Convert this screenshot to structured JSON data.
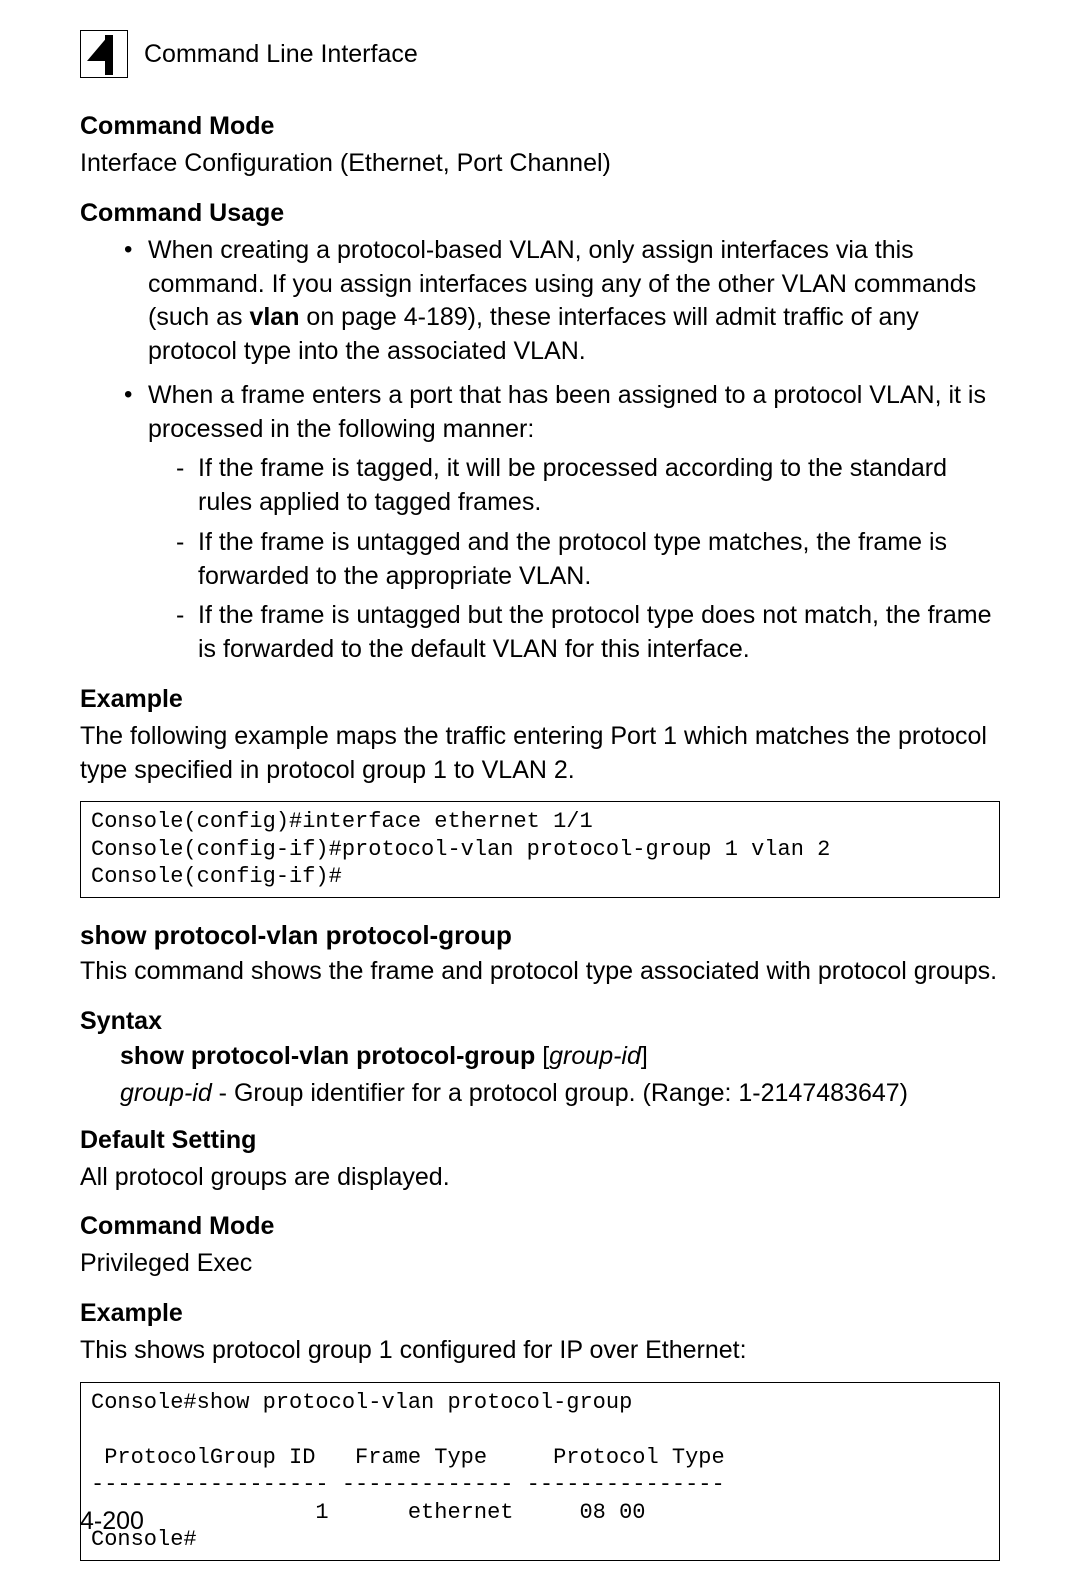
{
  "header": {
    "chapter_number": "4",
    "title": "Command Line Interface"
  },
  "sec_cmd_mode1": {
    "heading": "Command Mode",
    "text": "Interface Configuration (Ethernet, Port Channel)"
  },
  "sec_cmd_usage": {
    "heading": "Command Usage",
    "b1_a": "When creating a protocol-based VLAN, only assign interfaces via this command. If you assign interfaces using any of the other VLAN commands (such as ",
    "b1_bold": "vlan",
    "b1_b": " on page 4-189), these interfaces will admit traffic of any protocol type into the associated VLAN.",
    "b2": "When a frame enters a port that has been assigned to a protocol VLAN, it is processed in the following manner:",
    "b2_d1": "If the frame is tagged, it will be processed according to the standard rules applied to tagged frames.",
    "b2_d2": "If the frame is untagged and the protocol type matches, the frame is forwarded to the appropriate VLAN.",
    "b2_d3": "If the frame is untagged but the protocol type does not match, the frame is forwarded to the default VLAN for this interface."
  },
  "sec_example1": {
    "heading": "Example",
    "text": "The following example maps the traffic entering Port 1 which matches the protocol type specified in protocol group 1 to VLAN 2.",
    "code": "Console(config)#interface ethernet 1/1\nConsole(config-if)#protocol-vlan protocol-group 1 vlan 2\nConsole(config-if)#"
  },
  "sec_show_cmd": {
    "title": "show protocol-vlan protocol-group",
    "desc": "This command shows the frame and protocol type associated with protocol groups."
  },
  "sec_syntax": {
    "heading": "Syntax",
    "cmd_bold": "show protocol-vlan protocol-group",
    "cmd_arg_open": " [",
    "cmd_arg_italic": "group-id",
    "cmd_arg_close": "]",
    "param_italic": "group-id",
    "param_rest": " - Group identifier for a protocol group. (Range: 1-2147483647)"
  },
  "sec_default": {
    "heading": "Default Setting",
    "text": "All protocol groups are displayed."
  },
  "sec_cmd_mode2": {
    "heading": "Command Mode",
    "text": "Privileged Exec"
  },
  "sec_example2": {
    "heading": "Example",
    "text": "This shows protocol group 1 configured for IP over Ethernet:",
    "code": "Console#show protocol-vlan protocol-group\n\n ProtocolGroup ID   Frame Type     Protocol Type\n------------------ ------------- ---------------\n                 1      ethernet     08 00\nConsole#"
  },
  "page_number": "4-200"
}
